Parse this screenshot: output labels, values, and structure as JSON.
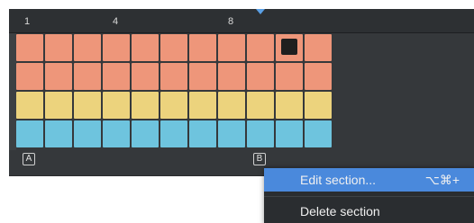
{
  "ruler": {
    "marks": [
      "1",
      "4",
      "8"
    ]
  },
  "grid": {
    "columns": 11,
    "rows": [
      {
        "color": "salmon",
        "cells": 11,
        "marked_col": 9
      },
      {
        "color": "salmon",
        "cells": 11,
        "marked_col": null
      },
      {
        "color": "yellow",
        "cells": 11,
        "marked_col": null
      },
      {
        "color": "blue",
        "cells": 11,
        "marked_col": null
      }
    ]
  },
  "sections": {
    "a": "A",
    "b": "B"
  },
  "context_menu": {
    "items": [
      {
        "label": "Edit section...",
        "shortcut": "⌥⌘+",
        "selected": true
      },
      {
        "label": "Delete section",
        "shortcut": "",
        "selected": false
      }
    ]
  },
  "colors": {
    "salmon": "#ee967a",
    "yellow": "#ecd37d",
    "blue": "#6ec4de",
    "accent": "#4a89dc"
  },
  "icons": {
    "playhead": "playhead-triangle-icon"
  }
}
